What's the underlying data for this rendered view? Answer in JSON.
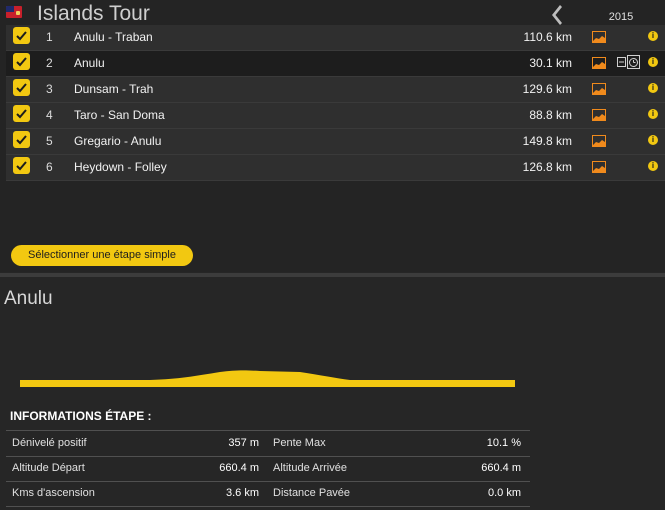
{
  "header": {
    "title": "Islands Tour",
    "year": "2015"
  },
  "stages": [
    {
      "num": "1",
      "name": "Anulu - Traban",
      "distance": "110.6 km",
      "checked": true,
      "has_clock": false
    },
    {
      "num": "2",
      "name": "Anulu",
      "distance": "30.1 km",
      "checked": true,
      "has_clock": true
    },
    {
      "num": "3",
      "name": "Dunsam - Trah",
      "distance": "129.6 km",
      "checked": true,
      "has_clock": false
    },
    {
      "num": "4",
      "name": "Taro - San Doma",
      "distance": "88.8 km",
      "checked": true,
      "has_clock": false
    },
    {
      "num": "5",
      "name": "Gregario - Anulu",
      "distance": "149.8 km",
      "checked": true,
      "has_clock": false
    },
    {
      "num": "6",
      "name": "Heydown - Folley",
      "distance": "126.8 km",
      "checked": true,
      "has_clock": false
    }
  ],
  "select_button": "Sélectionner une étape simple",
  "stage_detail": {
    "name": "Anulu",
    "info_header": "INFORMATIONS ÉTAPE :",
    "rows": [
      {
        "left_label": "Dénivelé positif",
        "left_value": "357 m",
        "right_label": "Pente Max",
        "right_value": "10.1 %"
      },
      {
        "left_label": "Altitude Départ",
        "left_value": "660.4 m",
        "right_label": "Altitude Arrivée",
        "right_value": "660.4 m"
      },
      {
        "left_label": "Kms d'ascension",
        "left_value": "3.6 km",
        "right_label": "Distance Pavée",
        "right_value": "0.0 km"
      }
    ]
  },
  "colors": {
    "accent": "#f2c811",
    "profile_orange": "#f08a1c",
    "background": "#262626"
  },
  "icons": {
    "flag": "flag-icon",
    "back": "chevron-left-icon",
    "check": "checkmark-icon",
    "profile": "stage-profile-icon",
    "time_trial": "time-trial-icon",
    "info": "info-icon"
  }
}
